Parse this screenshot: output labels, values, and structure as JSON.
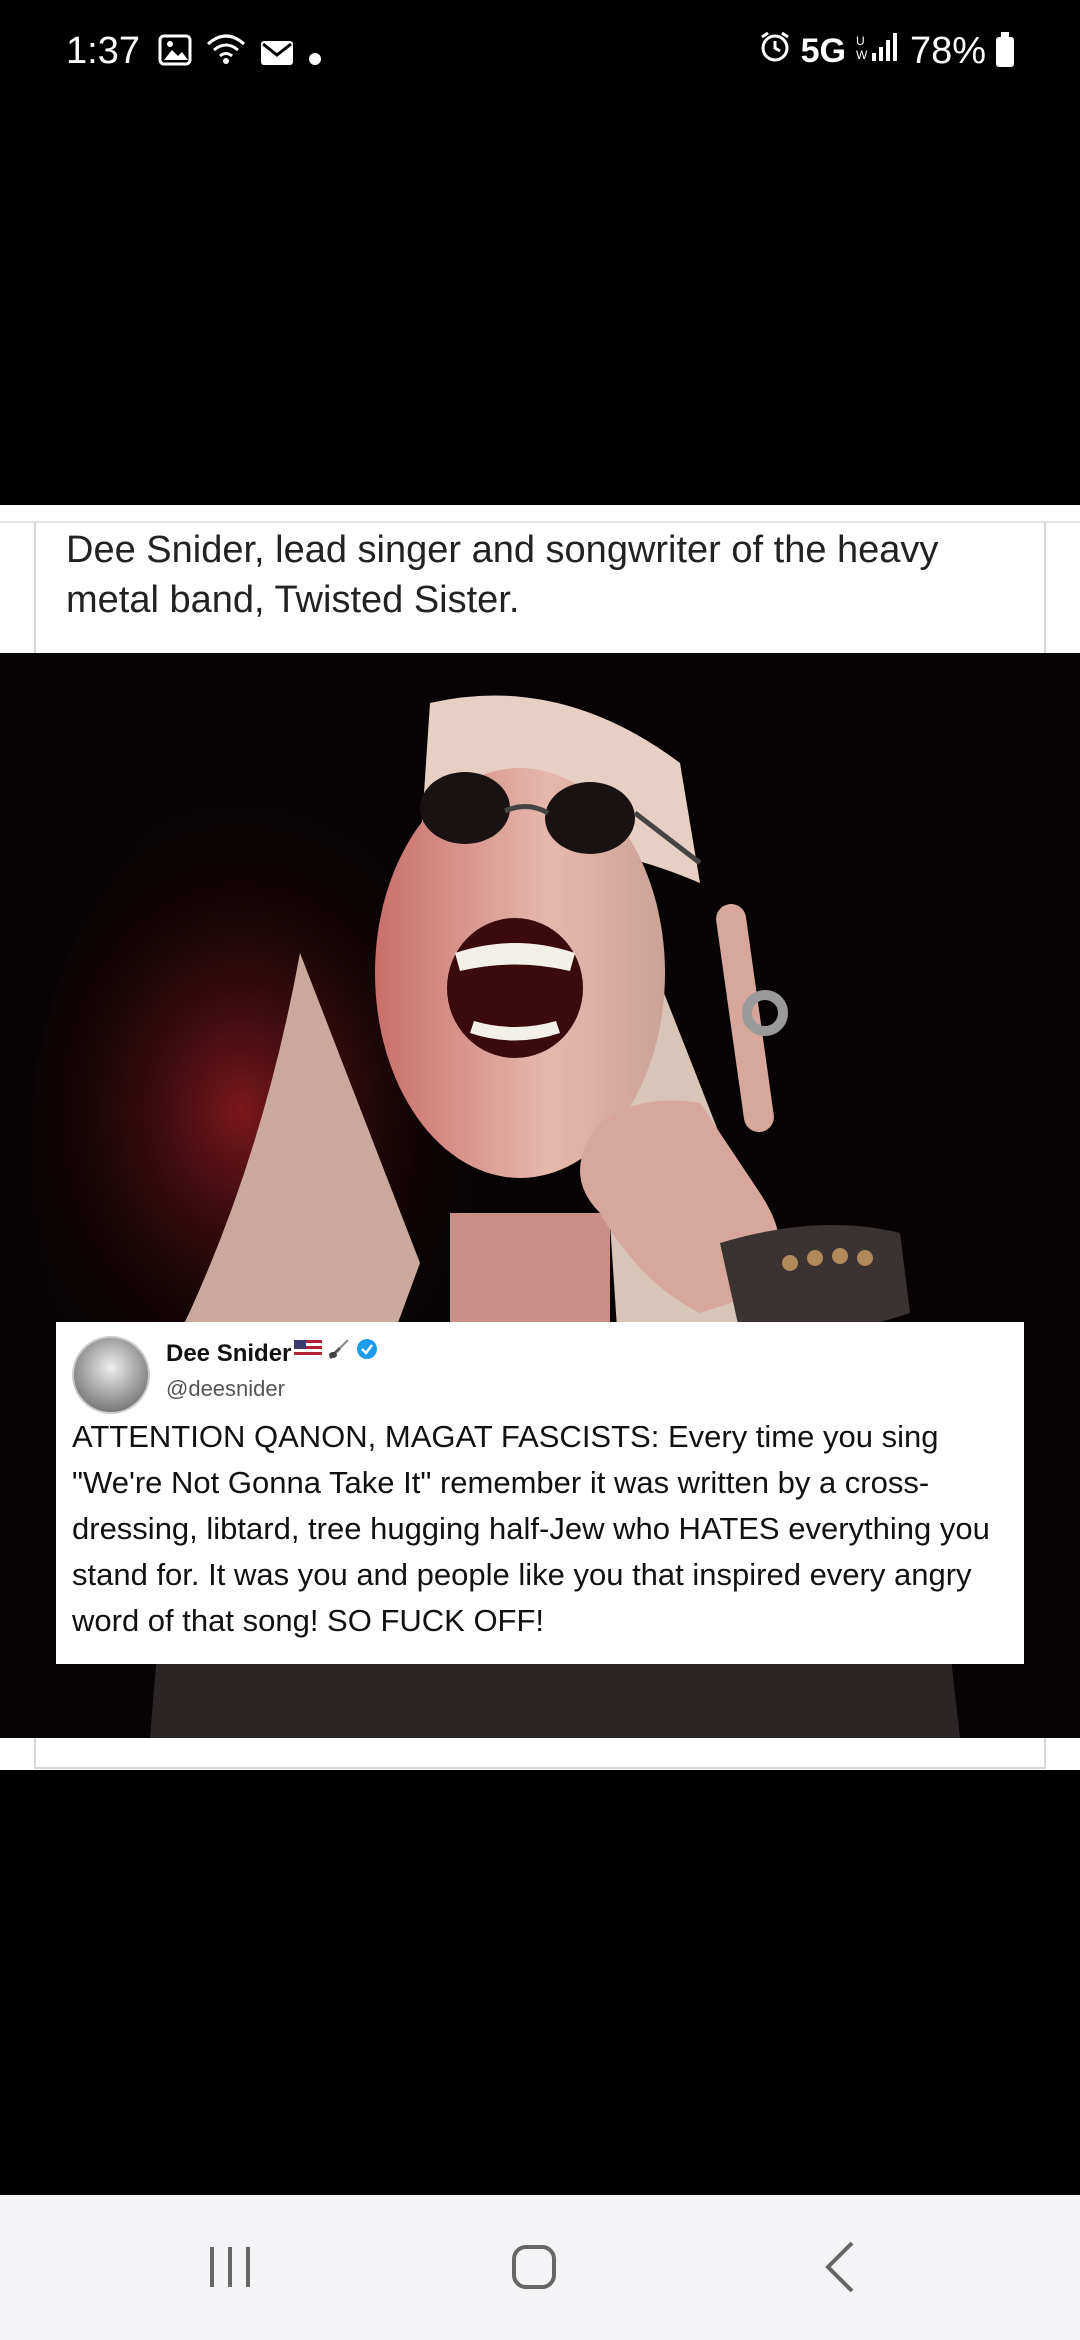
{
  "status_bar": {
    "time": "1:37",
    "network": "5G",
    "battery": "78%"
  },
  "post": {
    "caption": "Dee Snider, lead singer and songwriter of the heavy metal band, Twisted Sister."
  },
  "tweet": {
    "name": "Dee Snider",
    "handle": "@deesnider",
    "text": "ATTENTION QANON, MAGAT FASCISTS: Every time you sing \"We're Not Gonna Take It\" remember it was written by a cross-dressing, libtard, tree hugging half-Jew who HATES everything you stand for. It was you and people like you that inspired every angry word of that song! SO FUCK OFF!"
  },
  "icons": {
    "gallery": "gallery-icon",
    "wifi": "wifi-icon",
    "mail": "mail-icon",
    "alarm": "alarm-icon",
    "signal": "signal-icon",
    "battery": "battery-icon",
    "flag": "us-flag-icon",
    "guitar": "guitar-icon",
    "verified": "verified-badge-icon"
  },
  "colors": {
    "verified": "#1d9bf0",
    "nav_bg": "#f4f4f6"
  }
}
